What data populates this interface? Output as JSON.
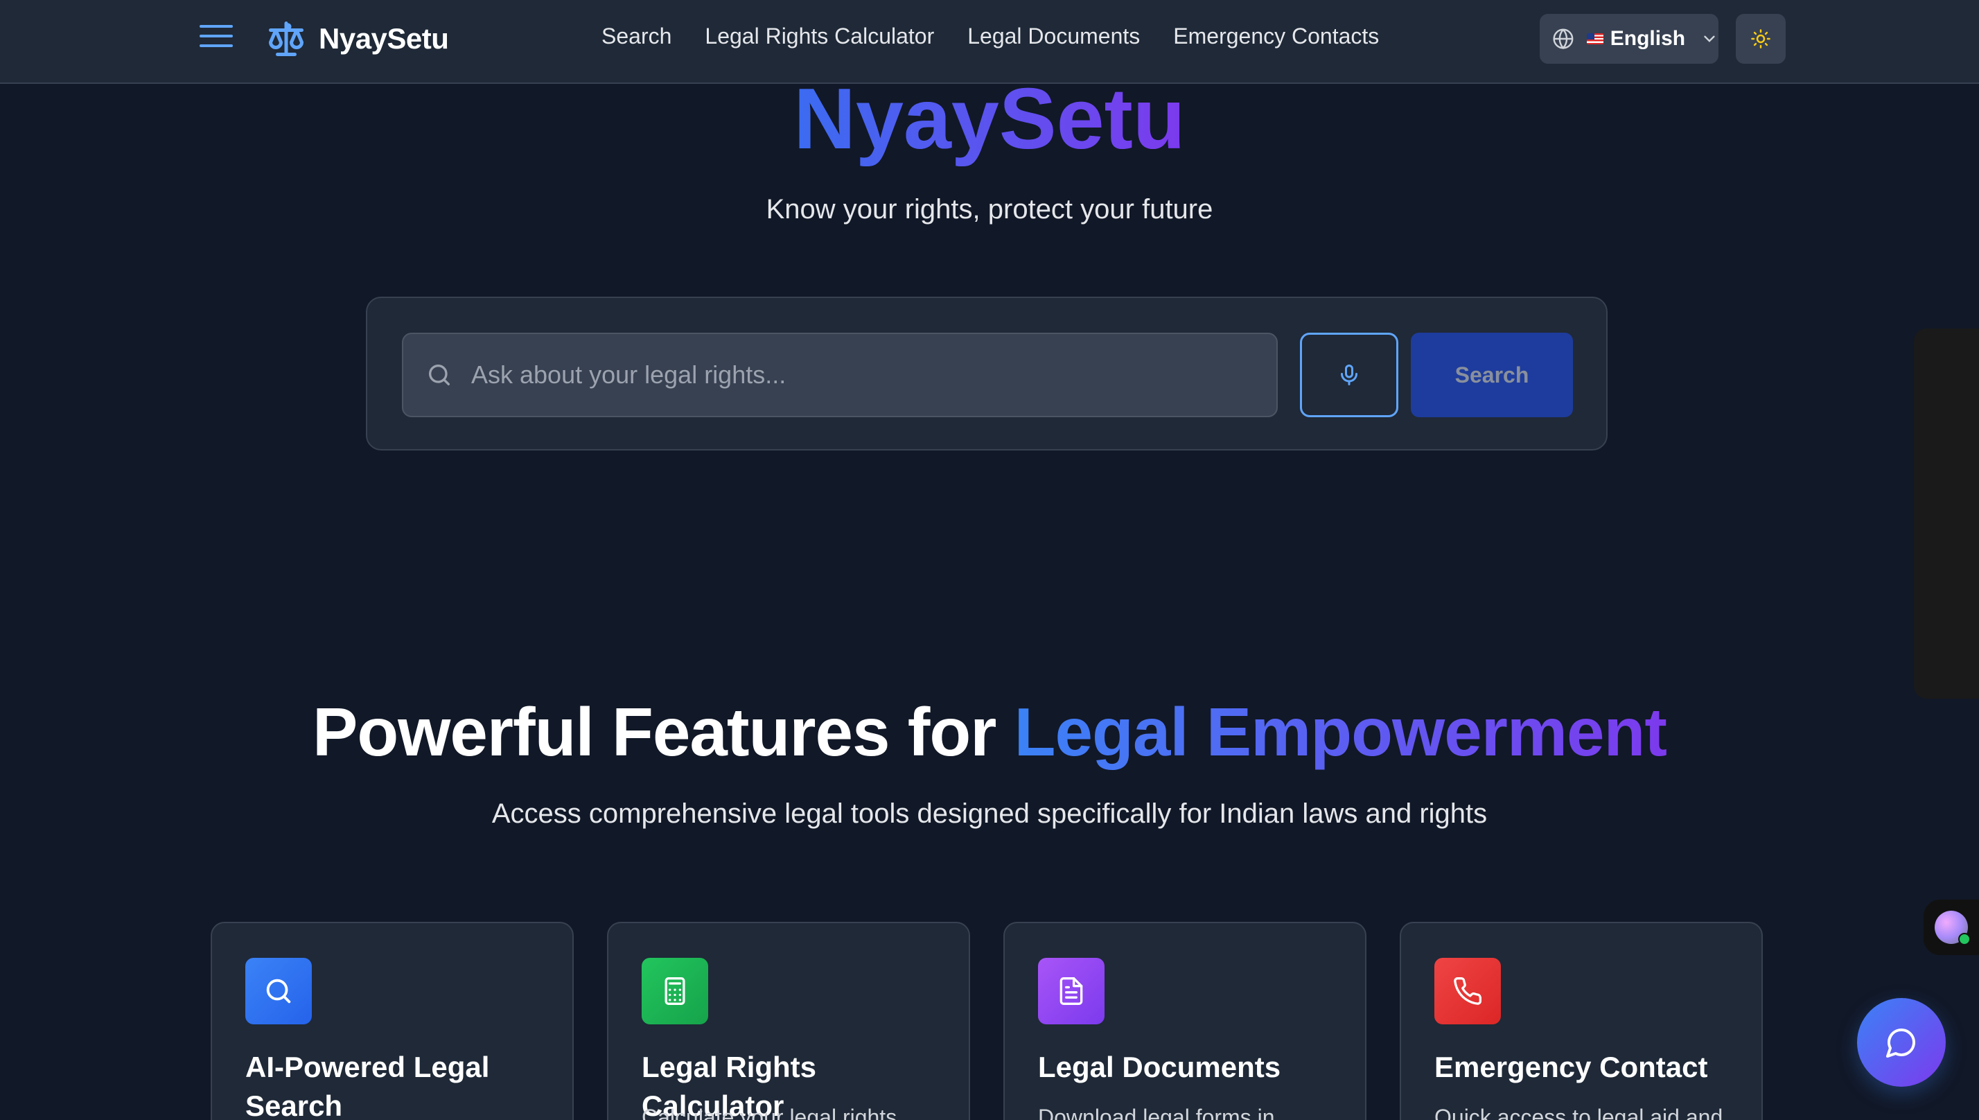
{
  "header": {
    "brand": "NyaySetu",
    "nav": [
      "Search",
      "Legal Rights Calculator",
      "Legal Documents",
      "Emergency Contacts"
    ],
    "language": "English"
  },
  "hero": {
    "title": "NyaySetu",
    "subtitle": "Know your rights, protect your future",
    "search_placeholder": "Ask about your legal rights...",
    "search_button": "Search"
  },
  "features": {
    "title_prefix": "Powerful Features for ",
    "title_highlight": "Legal Empowerment",
    "subtitle": "Access comprehensive legal tools designed specifically for Indian laws and rights",
    "cards": [
      {
        "title": "AI-Powered Legal Search",
        "desc": "",
        "icon": "search-icon",
        "color": "#3b82f6"
      },
      {
        "title": "Legal Rights Calculator",
        "desc": "Calculate your legal rights",
        "icon": "calculator-icon",
        "color": "#22c55e"
      },
      {
        "title": "Legal Documents",
        "desc": "Download legal forms in",
        "icon": "document-icon",
        "color": "#a855f7"
      },
      {
        "title": "Emergency Contact",
        "desc": "Quick access to legal aid and",
        "icon": "phone-icon",
        "color": "#ef4444"
      }
    ]
  }
}
